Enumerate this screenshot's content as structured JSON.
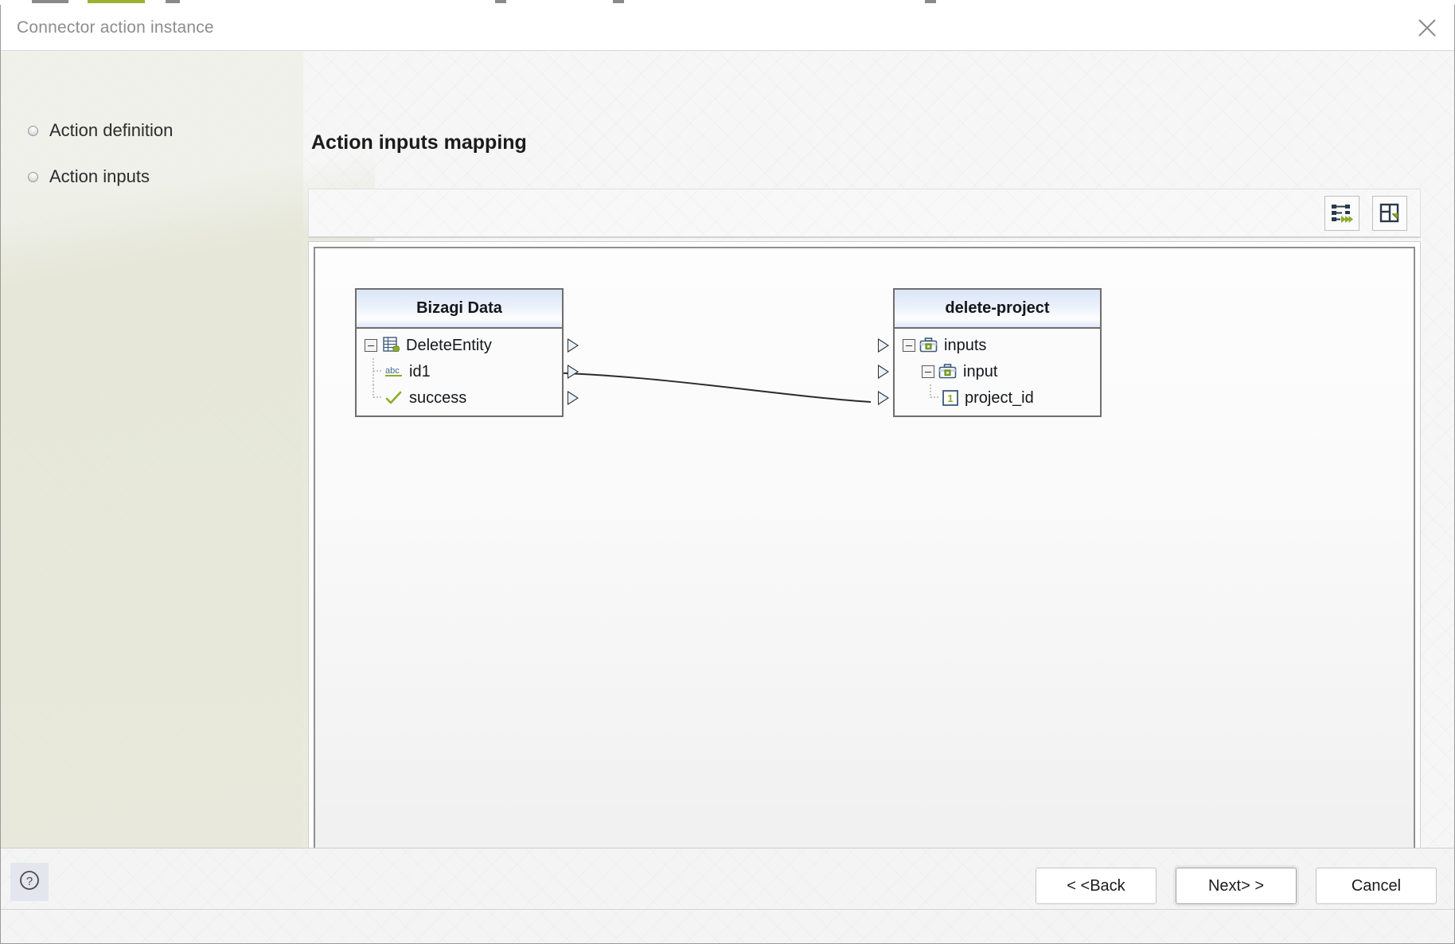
{
  "window": {
    "title": "Connector action instance",
    "close_icon": "close-icon"
  },
  "sidebar": {
    "items": [
      {
        "label": "Action definition",
        "bullet_icon": "bullet-diamond-icon"
      },
      {
        "label": "Action inputs",
        "bullet_icon": "bullet-diamond-icon"
      }
    ]
  },
  "main": {
    "page_title": "Action inputs mapping",
    "toolbar": {
      "buttons": [
        {
          "name": "auto-map-button",
          "icon": "auto-map-icon"
        },
        {
          "name": "fit-to-window-button",
          "icon": "fit-to-window-icon"
        }
      ]
    },
    "mapping": {
      "source_node": {
        "title": "Bizagi Data",
        "rows": [
          {
            "label": "DeleteEntity",
            "icon": "entity-icon",
            "expander": "collapse-icon",
            "indent": 0,
            "port": "right"
          },
          {
            "label": "id1",
            "icon": "abc-string-icon",
            "expander": null,
            "indent": 1,
            "port": "right"
          },
          {
            "label": "success",
            "icon": "boolean-check-icon",
            "expander": null,
            "indent": 1,
            "port": "right"
          }
        ]
      },
      "target_node": {
        "title": "delete-project",
        "rows": [
          {
            "label": "inputs",
            "icon": "briefcase-icon",
            "expander": "collapse-icon",
            "indent": 0,
            "port": "left"
          },
          {
            "label": "input",
            "icon": "briefcase-icon",
            "expander": "collapse-icon",
            "indent": 1,
            "port": "left"
          },
          {
            "label": "project_id",
            "icon": "number-one-icon",
            "expander": null,
            "indent": 2,
            "port": "left"
          }
        ]
      },
      "connections": [
        {
          "from": "id1",
          "to": "project_id"
        }
      ]
    }
  },
  "footer": {
    "help_icon": "help-question-icon",
    "buttons": [
      {
        "name": "back-button",
        "label": "< <Back",
        "default": false
      },
      {
        "name": "next-button",
        "label": "Next> >",
        "default": true
      },
      {
        "name": "cancel-button",
        "label": "Cancel",
        "default": false
      }
    ]
  },
  "colors": {
    "accent_olive": "#9cb130",
    "node_header_blue": "#dbe5f7",
    "icon_dark": "#2b3a4a",
    "icon_green": "#8aac2b"
  }
}
